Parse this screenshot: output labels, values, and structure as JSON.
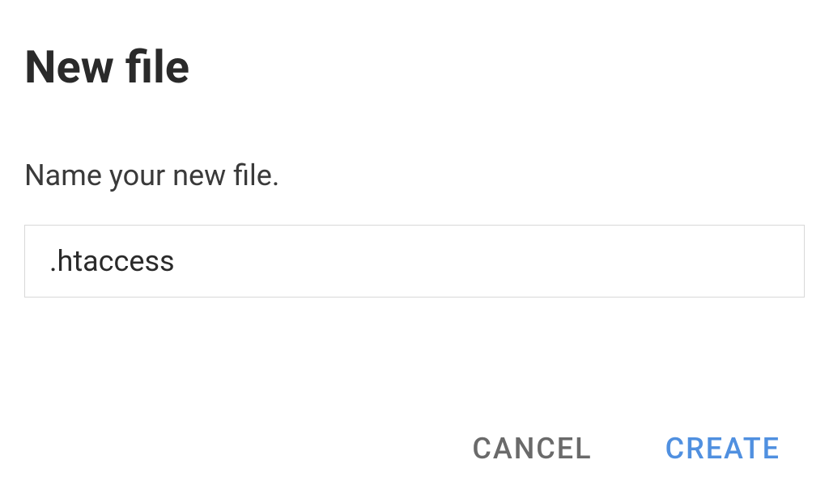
{
  "dialog": {
    "title": "New file",
    "label": "Name your new file.",
    "input_value": ".htaccess",
    "cancel_label": "CANCEL",
    "create_label": "CREATE"
  }
}
